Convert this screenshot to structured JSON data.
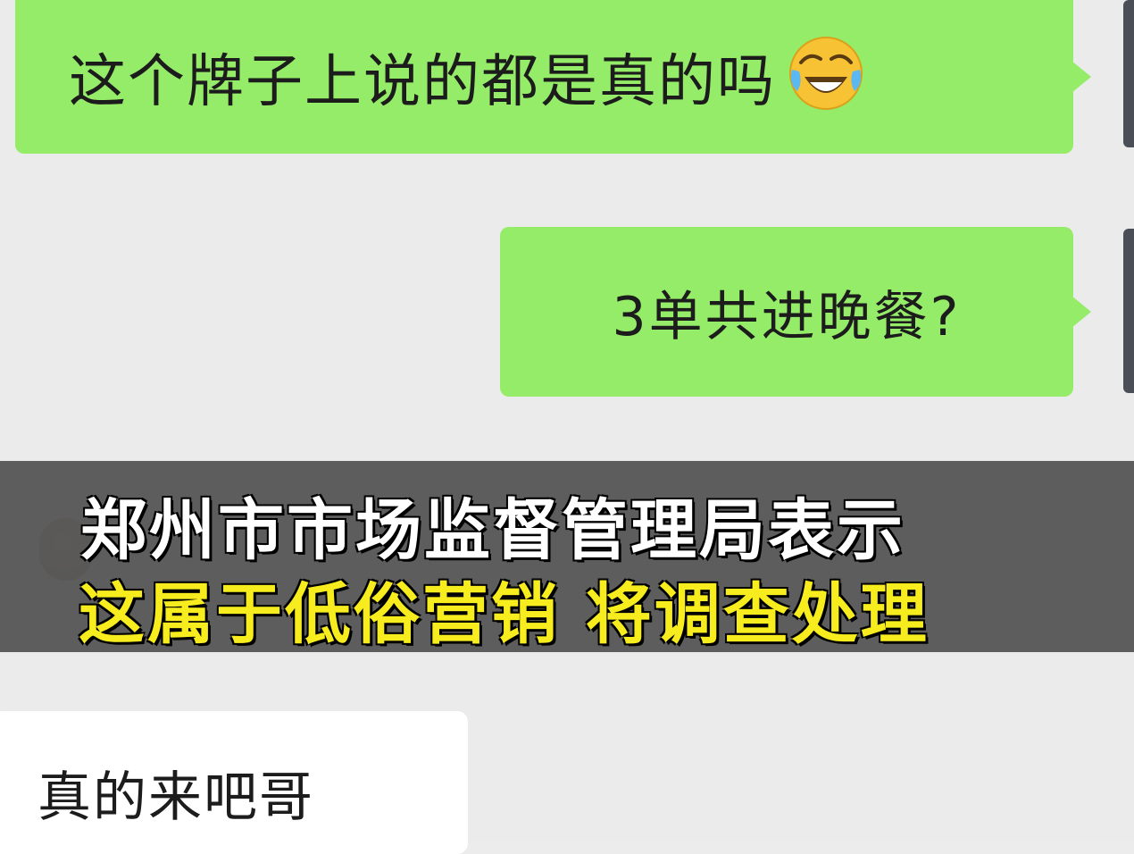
{
  "messages": [
    {
      "side": "sent",
      "text": "这个牌子上说的都是真的吗",
      "emoji": "crying-laughing-face-icon"
    },
    {
      "side": "sent",
      "text": "3单共进晚餐?"
    },
    {
      "side": "received",
      "text": "真的来吧哥"
    }
  ],
  "banner": {
    "line1": "郑州市市场监督管理局表示",
    "line2": "这属于低俗营销 将调查处理"
  },
  "colors": {
    "sent_bubble": "#95ec69",
    "received_bubble": "#ffffff",
    "chat_background": "#ebebeb",
    "banner_background": "#585858",
    "banner_line1_text": "#ffffff",
    "banner_line2_text": "#f7ec1e"
  }
}
